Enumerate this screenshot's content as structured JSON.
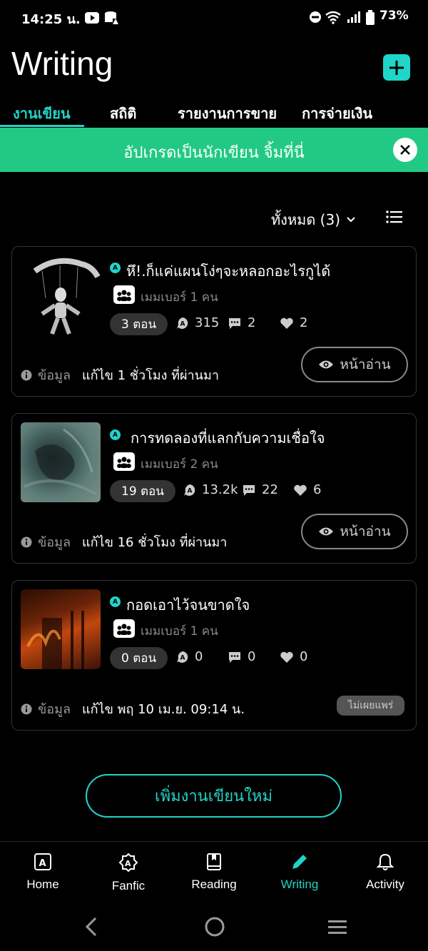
{
  "status_bar": {
    "time": "14:25 น.",
    "battery": "73%"
  },
  "header": {
    "title": "Writing",
    "add_icon": "plus-icon"
  },
  "tabs": [
    {
      "label": "งานเขียน",
      "active": true
    },
    {
      "label": "สถิติ",
      "active": false
    },
    {
      "label": "รายงานการขาย",
      "active": false
    },
    {
      "label": "การจ่ายเงิน",
      "active": false
    }
  ],
  "banner": {
    "text": "อัปเกรดเป็นนักเขียน จิ้มที่นี่"
  },
  "filter": {
    "label": "ทั้งหมด (3)"
  },
  "stories": [
    {
      "title": "หึ!.ก็แค่แผนโง่ๆจะหลอกอะไรกูได้",
      "members": "เมมเบอร์ 1 คน",
      "chapters": "3 ตอน",
      "views": "315",
      "comments": "2",
      "likes": "2",
      "info_label": "ข้อมูล",
      "edited": "แก้ไข 1 ชั่วโมง ที่ผ่านมา",
      "action": "หน้าอ่าน"
    },
    {
      "title": "การทดลองที่แลกกับความเชื่อใจ",
      "members": "เมมเบอร์ 2 คน",
      "chapters": "19 ตอน",
      "views": "13.2k",
      "comments": "22",
      "likes": "6",
      "info_label": "ข้อมูล",
      "edited": "แก้ไข 16 ชั่วโมง ที่ผ่านมา",
      "action": "หน้าอ่าน"
    },
    {
      "title": "กอดเอาไว้จนขาดใจ",
      "members": "เมมเบอร์ 1 คน",
      "chapters": "0 ตอน",
      "views": "0",
      "comments": "0",
      "likes": "0",
      "info_label": "ข้อมูล",
      "edited": "แก้ไข พฤ 10 เม.ย. 09:14 น.",
      "status": "ไม่เผยแพร่"
    }
  ],
  "new_writing": "เพิ่มงานเขียนใหม่",
  "bottom_nav": [
    {
      "label": "Home",
      "icon": "home-icon"
    },
    {
      "label": "Fanfic",
      "icon": "fanfic-icon"
    },
    {
      "label": "Reading",
      "icon": "book-icon"
    },
    {
      "label": "Writing",
      "icon": "pencil-icon",
      "active": true
    },
    {
      "label": "Activity",
      "icon": "bell-icon"
    }
  ],
  "colors": {
    "accent": "#22d3c9",
    "banner": "#22c985",
    "background": "#000000"
  }
}
